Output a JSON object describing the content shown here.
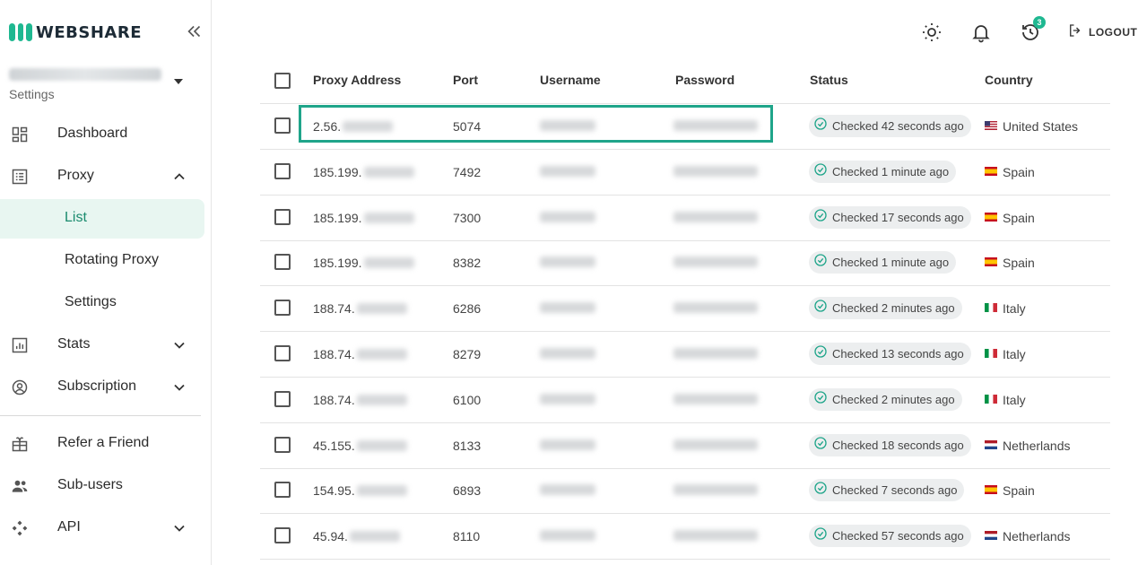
{
  "sidebar": {
    "brand": "WEBSHARE",
    "account_label": "Settings",
    "items": [
      {
        "label": "Dashboard",
        "icon": "dashboard-icon"
      },
      {
        "label": "Proxy",
        "icon": "list-icon"
      },
      {
        "label": "List"
      },
      {
        "label": "Rotating Proxy"
      },
      {
        "label": "Settings"
      },
      {
        "label": "Stats",
        "icon": "stats-icon"
      },
      {
        "label": "Subscription",
        "icon": "account-circle-icon"
      },
      {
        "label": "Refer a Friend",
        "icon": "gift-icon"
      },
      {
        "label": "Sub-users",
        "icon": "users-icon"
      },
      {
        "label": "API",
        "icon": "api-icon"
      }
    ]
  },
  "header": {
    "notification_count": "3",
    "logout_label": "LOGOUT"
  },
  "table": {
    "columns": [
      "Proxy Address",
      "Port",
      "Username",
      "Password",
      "Status",
      "Country"
    ],
    "rows": [
      {
        "ip": "2.56.",
        "port": "5074",
        "status": "Checked 42 seconds ago",
        "country": "United States",
        "flag": "us"
      },
      {
        "ip": "185.199.",
        "port": "7492",
        "status": "Checked 1 minute ago",
        "country": "Spain",
        "flag": "es"
      },
      {
        "ip": "185.199.",
        "port": "7300",
        "status": "Checked 17 seconds ago",
        "country": "Spain",
        "flag": "es"
      },
      {
        "ip": "185.199.",
        "port": "8382",
        "status": "Checked 1 minute ago",
        "country": "Spain",
        "flag": "es"
      },
      {
        "ip": "188.74.",
        "port": "6286",
        "status": "Checked 2 minutes ago",
        "country": "Italy",
        "flag": "it"
      },
      {
        "ip": "188.74.",
        "port": "8279",
        "status": "Checked 13 seconds ago",
        "country": "Italy",
        "flag": "it"
      },
      {
        "ip": "188.74.",
        "port": "6100",
        "status": "Checked 2 minutes ago",
        "country": "Italy",
        "flag": "it"
      },
      {
        "ip": "45.155.",
        "port": "8133",
        "status": "Checked 18 seconds ago",
        "country": "Netherlands",
        "flag": "nl"
      },
      {
        "ip": "154.95.",
        "port": "6893",
        "status": "Checked 7 seconds ago",
        "country": "Spain",
        "flag": "es"
      },
      {
        "ip": "45.94.",
        "port": "8110",
        "status": "Checked 57 seconds ago",
        "country": "Netherlands",
        "flag": "nl"
      }
    ]
  },
  "colors": {
    "brand": "#1fb891",
    "highlight": "#1fa58a",
    "active_bg": "#e8f6f1",
    "active_text": "#1a8b6e"
  }
}
